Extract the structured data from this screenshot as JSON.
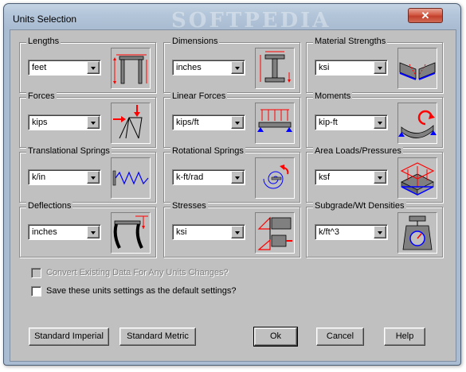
{
  "window": {
    "title": "Units Selection",
    "close_glyph": "✕",
    "watermark": "SOFTPEDIA"
  },
  "groups": {
    "lengths": {
      "label": "Lengths",
      "value": "feet",
      "icon": "portal-frame-icon"
    },
    "dimensions": {
      "label": "Dimensions",
      "value": "inches",
      "icon": "i-beam-section-icon"
    },
    "material_strengths": {
      "label": "Material Strengths",
      "value": "ksi",
      "icon": "material-strength-icon"
    },
    "forces": {
      "label": "Forces",
      "value": "kips",
      "icon": "truss-force-icon"
    },
    "linear_forces": {
      "label": "Linear Forces",
      "value": "kips/ft",
      "icon": "distributed-load-icon"
    },
    "moments": {
      "label": "Moments",
      "value": "kip-ft",
      "icon": "moment-icon"
    },
    "translational_springs": {
      "label": "Translational Springs",
      "value": "k/in",
      "icon": "spring-icon"
    },
    "rotational_springs": {
      "label": "Rotational Springs",
      "value": "k-ft/rad",
      "icon": "rotational-spring-icon"
    },
    "area_loads": {
      "label": "Area Loads/Pressures",
      "value": "ksf",
      "icon": "area-load-icon"
    },
    "deflections": {
      "label": "Deflections",
      "value": "inches",
      "icon": "deflected-frame-icon"
    },
    "stresses": {
      "label": "Stresses",
      "value": "ksi",
      "icon": "stress-icon"
    },
    "subgrade": {
      "label": "Subgrade/Wt Densities",
      "value": "k/ft^3",
      "icon": "scale-icon"
    }
  },
  "options": {
    "convert_label": "Convert Existing Data For Any Units Changes?",
    "convert_checked": false,
    "convert_enabled": false,
    "save_default_label": "Save these units settings as the default settings?",
    "save_default_checked": false
  },
  "buttons": {
    "standard_imperial": "Standard Imperial",
    "standard_metric": "Standard Metric",
    "ok": "Ok",
    "cancel": "Cancel",
    "help": "Help"
  },
  "colors": {
    "icon_red": "#ff0000",
    "icon_blue": "#0000ff",
    "window_frame": "#a9bcd1",
    "face": "#c0c0c0"
  }
}
